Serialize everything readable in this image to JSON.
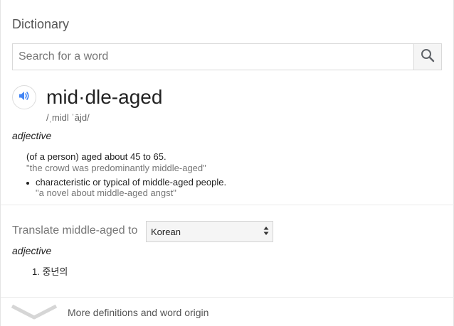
{
  "panel": {
    "title": "Dictionary"
  },
  "search": {
    "placeholder": "Search for a word",
    "value": ""
  },
  "entry": {
    "headword": "mid·dle-aged",
    "phonetic": "/ˌmidl ˈājd/",
    "part_of_speech": "adjective",
    "senses": [
      {
        "definition": "(of a person) aged about 45 to 65.",
        "example": "\"the crowd was predominantly middle-aged\""
      }
    ],
    "subsenses": [
      {
        "definition": "characteristic or typical of middle-aged people.",
        "example": "\"a novel about middle-aged angst\""
      }
    ]
  },
  "translate": {
    "label": "Translate middle-aged to",
    "selected_language": "Korean",
    "part_of_speech": "adjective",
    "results": [
      "1. 중년의"
    ]
  },
  "footer": {
    "more_label": "More definitions and word origin"
  },
  "icons": {
    "search": "search-icon",
    "speaker": "speaker-icon",
    "select_arrows": "updown-arrows-icon",
    "expand": "chevron-down-icon"
  },
  "colors": {
    "accent_blue": "#4285f4",
    "border": "#d9d9d9",
    "muted_text": "#777777"
  }
}
